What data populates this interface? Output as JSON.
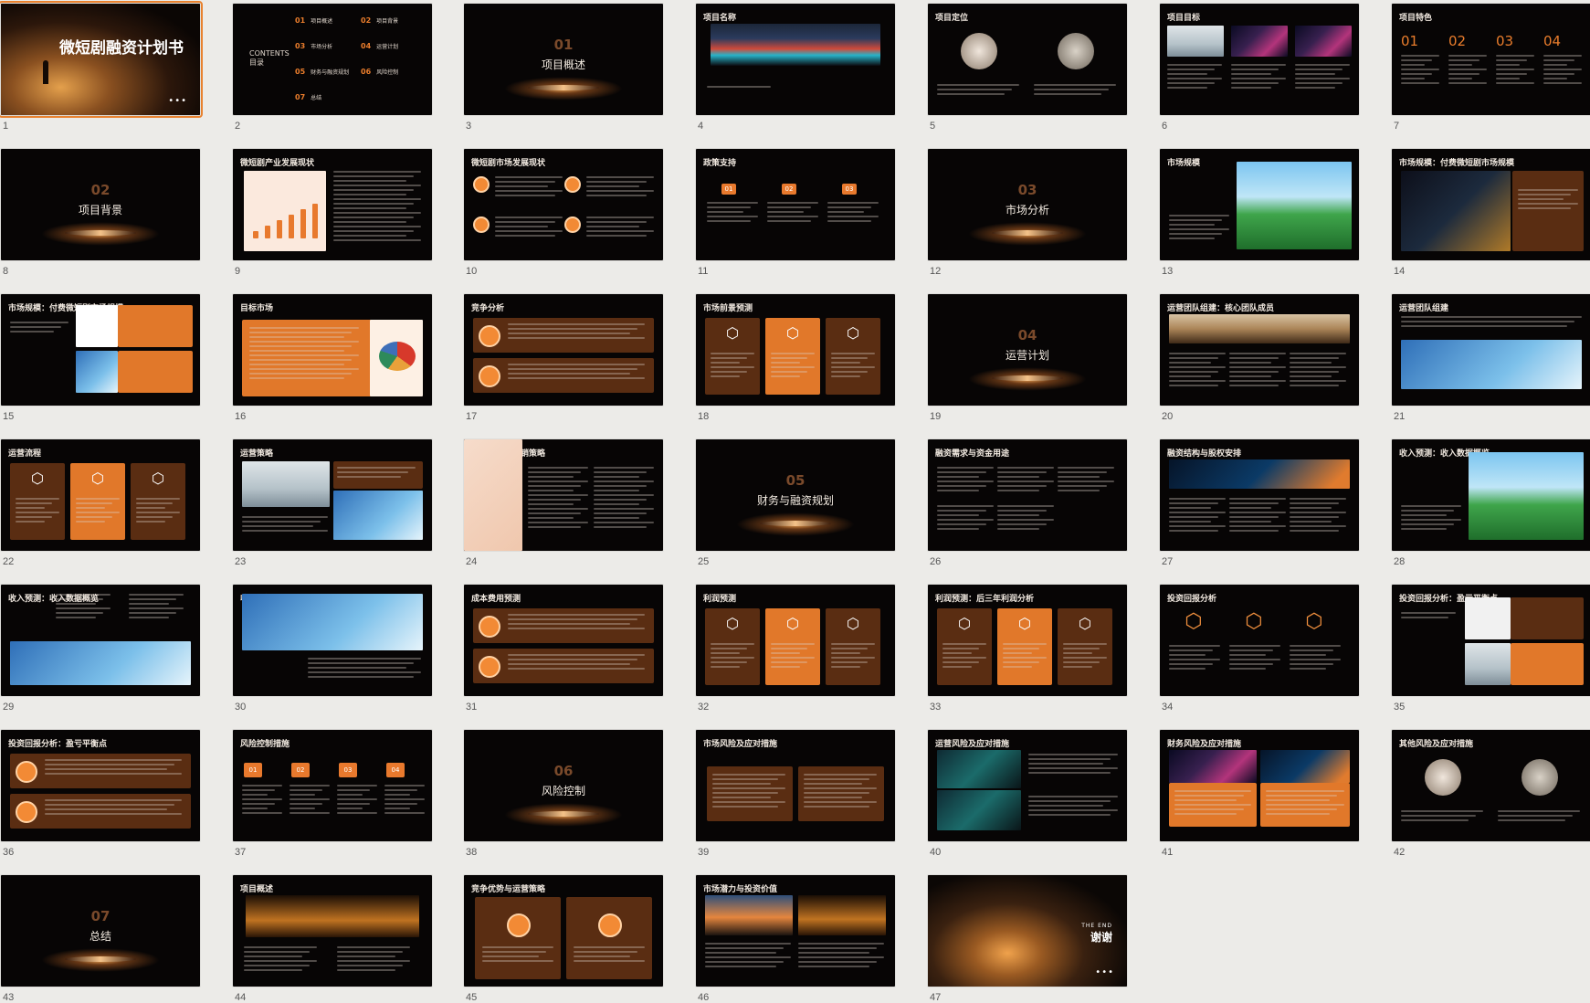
{
  "slides": [
    {
      "n": "1",
      "type": "cover",
      "title": "微短剧融资计划书",
      "selected": true
    },
    {
      "n": "2",
      "type": "toc",
      "title": "CONTENTS 目录",
      "items": [
        [
          "01",
          "项目概述"
        ],
        [
          "02",
          "项目背景"
        ],
        [
          "03",
          "市场分析"
        ],
        [
          "04",
          "运营计划"
        ],
        [
          "05",
          "财务与融资规划"
        ],
        [
          "06",
          "风险控制"
        ],
        [
          "07",
          "总结"
        ]
      ]
    },
    {
      "n": "3",
      "type": "section",
      "num": "01",
      "title": "项目概述"
    },
    {
      "n": "4",
      "type": "image-top",
      "title": "项目名称"
    },
    {
      "n": "5",
      "type": "two-circles",
      "title": "项目定位"
    },
    {
      "n": "6",
      "type": "three-img",
      "title": "项目目标"
    },
    {
      "n": "7",
      "type": "four-num",
      "title": "项目特色",
      "nums": [
        "01",
        "02",
        "03",
        "04"
      ]
    },
    {
      "n": "8",
      "type": "section",
      "num": "02",
      "title": "项目背景"
    },
    {
      "n": "9",
      "type": "chart-left",
      "title": "微短剧产业发展现状"
    },
    {
      "n": "10",
      "type": "four-icons",
      "title": "微短剧市场发展现状"
    },
    {
      "n": "11",
      "type": "three-badges",
      "title": "政策支持",
      "nums": [
        "01",
        "02",
        "03"
      ]
    },
    {
      "n": "12",
      "type": "section",
      "num": "03",
      "title": "市场分析"
    },
    {
      "n": "13",
      "type": "image-right",
      "title": "市场规模"
    },
    {
      "n": "14",
      "type": "image-left-box",
      "title": "市场规模：付费微短剧市场规模"
    },
    {
      "n": "15",
      "type": "two-charts",
      "title": "市场规模：付费微短剧市场规模"
    },
    {
      "n": "16",
      "type": "orange-panel",
      "title": "目标市场"
    },
    {
      "n": "17",
      "type": "two-rows",
      "title": "竞争分析"
    },
    {
      "n": "18",
      "type": "three-cards",
      "title": "市场前景预测"
    },
    {
      "n": "19",
      "type": "section",
      "num": "04",
      "title": "运营计划"
    },
    {
      "n": "20",
      "type": "banner",
      "title": "运营团队组建：核心团队成员"
    },
    {
      "n": "21",
      "type": "banner-low",
      "title": "运营团队组建"
    },
    {
      "n": "22",
      "type": "three-cards",
      "title": "运营流程"
    },
    {
      "n": "23",
      "type": "two-img",
      "title": "运营策略"
    },
    {
      "n": "24",
      "type": "pink-left",
      "title": "运营策略：营销策略"
    },
    {
      "n": "25",
      "type": "section",
      "num": "05",
      "title": "财务与融资规划"
    },
    {
      "n": "26",
      "type": "text-grid",
      "title": "融资需求与资金用途"
    },
    {
      "n": "27",
      "type": "banner",
      "title": "融资结构与股权安排"
    },
    {
      "n": "28",
      "type": "image-right",
      "title": "收入预测：收入数据概览"
    },
    {
      "n": "29",
      "type": "text-over-img",
      "title": "收入预测：收入数据概览"
    },
    {
      "n": "30",
      "type": "big-img",
      "title": "收入预测"
    },
    {
      "n": "31",
      "type": "two-rows",
      "title": "成本费用预测"
    },
    {
      "n": "32",
      "type": "three-cards",
      "title": "利润预测"
    },
    {
      "n": "33",
      "type": "three-cards",
      "title": "利润预测：后三年利润分析"
    },
    {
      "n": "34",
      "type": "three-icons",
      "title": "投资回报分析"
    },
    {
      "n": "35",
      "type": "two-rows-right",
      "title": "投资回报分析：盈亏平衡点"
    },
    {
      "n": "36",
      "type": "two-rows",
      "title": "投资回报分析：盈亏平衡点"
    },
    {
      "n": "37",
      "type": "four-badges",
      "title": "风险控制措施",
      "nums": [
        "01",
        "02",
        "03",
        "04"
      ]
    },
    {
      "n": "38",
      "type": "section",
      "num": "06",
      "title": "风险控制"
    },
    {
      "n": "39",
      "type": "two-boxes",
      "title": "市场风险及应对措施"
    },
    {
      "n": "40",
      "type": "image-left",
      "title": "运营风险及应对措施"
    },
    {
      "n": "41",
      "type": "two-img-orange",
      "title": "财务风险及应对措施"
    },
    {
      "n": "42",
      "type": "two-circles",
      "title": "其他风险及应对措施"
    },
    {
      "n": "43",
      "type": "section",
      "num": "07",
      "title": "总结"
    },
    {
      "n": "44",
      "type": "image-top-gold",
      "title": "项目概述"
    },
    {
      "n": "45",
      "type": "two-big-cards",
      "title": "竞争优势与运营策略"
    },
    {
      "n": "46",
      "type": "two-img-top",
      "title": "市场潜力与投资价值"
    },
    {
      "n": "47",
      "type": "end",
      "title": "谢谢",
      "subtitle": "THE END"
    }
  ],
  "colors": {
    "accent": "#e8792d",
    "dark": "#070505",
    "brown": "#5a2d12"
  }
}
